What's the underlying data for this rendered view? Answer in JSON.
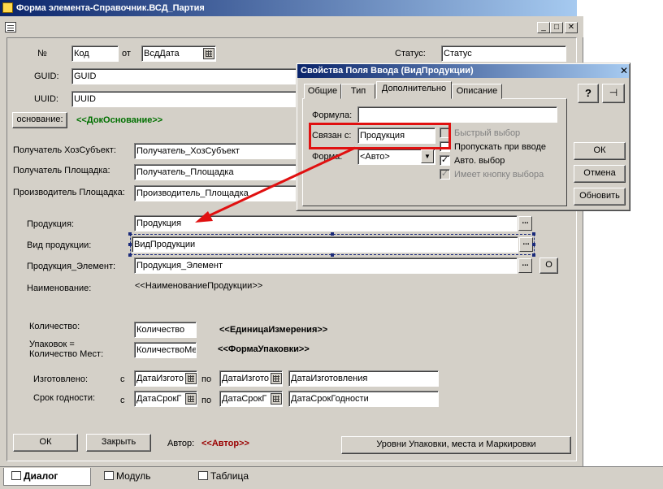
{
  "window": {
    "title": "Форма элемента-Справочник.ВСД_Партия",
    "minimize": "_",
    "maximize": "□",
    "close": "✕"
  },
  "form": {
    "num_label": "№",
    "code_value": "Код",
    "from_label": "от",
    "date_value": "ВсдДата",
    "status_label": "Статус:",
    "status_value": "Статус",
    "guid_label": "GUID:",
    "guid_value": "GUID",
    "uuid_label": "UUID:",
    "uuid_value": "UUID",
    "basis_button": "основание:",
    "basis_doc": "<<ДокОснование>>",
    "recipient_subject_label": "Получатель ХозСубъект:",
    "recipient_subject_value": "Получатель_ХозСубъект",
    "recipient_site_label": "Получатель Площадка:",
    "recipient_site_value": "Получатель_Площадка",
    "producer_site_label": "Производитель Площадка:",
    "producer_site_value": "Производитель_Площадка",
    "product_label": "Продукция:",
    "product_value": "Продукция",
    "product_type_label": "Вид продукции:",
    "product_type_value": "ВидПродукции",
    "product_element_label": "Продукция_Элемент:",
    "product_element_value": "Продукция_Элемент",
    "product_element_btn": "О",
    "name_label": "Наименование:",
    "name_value": "<<НаименованиеПродукции>>",
    "quantity_label": "Количество:",
    "quantity_value": "Количество",
    "unit_value": "<<ЕдиницаИзмерения>>",
    "packages_label_1": "Упаковок =",
    "packages_label_2": "Количество Мест:",
    "packages_value": "КоличествоМе",
    "package_form_value": "<<ФормаУпаковки>>",
    "made_label": "Изготовлено:",
    "made_from_label": "с",
    "made_from_value": "ДатаИзгото",
    "made_to_label": "по",
    "made_to_value": "ДатаИзгото",
    "made_text_value": "ДатаИзготовления",
    "expiry_label": "Срок годности:",
    "expiry_from_label": "с",
    "expiry_from_value": "ДатаСрокГ",
    "expiry_to_label": "по",
    "expiry_to_value": "ДатаСрокГ",
    "expiry_text_value": "ДатаСрокГодности",
    "ok_button": "ОК",
    "close_button": "Закрыть",
    "author_label": "Автор:",
    "author_value": "<<Автор>>",
    "levels_button": "Уровни Упаковки, места и Маркировки",
    "ellipsis": "..."
  },
  "dialog": {
    "title": "Свойства  Поля Ввода (ВидПродукции)",
    "close": "✕",
    "tabs": [
      "Общие",
      "Тип",
      "Дополнительно",
      "Описание"
    ],
    "help_button": "?",
    "pin_button": "⊣",
    "formula_label": "Формула:",
    "formula_value": "",
    "linked_label": "Связан с:",
    "linked_value": "Продукция",
    "form_label": "Форма:",
    "form_value": "<Авто>",
    "checkboxes": [
      {
        "label": "Быстрый выбор",
        "checked": false,
        "disabled": true
      },
      {
        "label": "Пропускать при вводе",
        "checked": false,
        "disabled": false
      },
      {
        "label": "Авто. выбор",
        "checked": true,
        "disabled": false
      },
      {
        "label": "Имеет кнопку выбора",
        "checked": true,
        "disabled": true
      }
    ],
    "ok_button": "ОК",
    "cancel_button": "Отмена",
    "refresh_button": "Обновить"
  },
  "bottom_tabs": [
    "Диалог",
    "Модуль",
    "Таблица"
  ],
  "colors": {
    "annotation_red": "#e01010",
    "basis_green": "#007000",
    "author_red": "#9a0000"
  }
}
